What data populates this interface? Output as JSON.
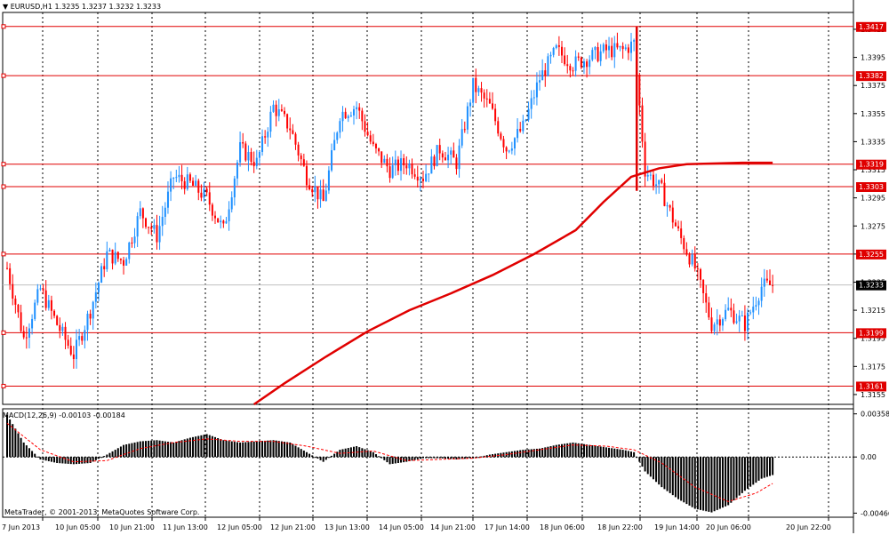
{
  "header": {
    "collapse_arrow": "triangle-down-icon",
    "symbol": "EURUSD,H1",
    "ohlc": "1.3235 1.3237 1.3232 1.3233"
  },
  "macd": {
    "label": "MACD(12,26,9) -0.00103 -0.00184",
    "scale": [
      "0.00358",
      "0.00",
      "-0.00466"
    ]
  },
  "copyright": "MetaTrader, © 2001-2013, MetaQuotes Software Corp.",
  "colors": {
    "grid": "#000000",
    "level_line": "#e00000",
    "ma_line": "#e00000",
    "bull_candle": "#1e90ff",
    "bear_candle": "#ff0000",
    "macd_hist": "#000000",
    "macd_signal": "#ff0000",
    "current_price_line": "#c0c0c0"
  },
  "chart_data": {
    "type": "candlestick",
    "symbol": "EURUSD",
    "timeframe": "H1",
    "price_axis": {
      "ylim": [
        1.3148,
        1.3427
      ],
      "tick_labels": [
        "1.3415",
        "1.3395",
        "1.3375",
        "1.3355",
        "1.3335",
        "1.3315",
        "1.3295",
        "1.3275",
        "1.3255",
        "1.3235",
        "1.3215",
        "1.3195",
        "1.3175",
        "1.3155"
      ]
    },
    "time_axis": {
      "tick_labels": [
        "7 Jun 2013",
        "10 Jun 05:00",
        "10 Jun 21:00",
        "11 Jun 13:00",
        "12 Jun 05:00",
        "12 Jun 21:00",
        "13 Jun 13:00",
        "14 Jun 05:00",
        "14 Jun 21:00",
        "17 Jun 14:00",
        "18 Jun 06:00",
        "18 Jun 22:00",
        "19 Jun 14:00",
        "20 Jun 06:00",
        "20 Jun 22:00"
      ]
    },
    "horizontal_levels": [
      "1.3417",
      "1.3382",
      "1.3319",
      "1.3303",
      "1.3255",
      "1.3199",
      "1.3161"
    ],
    "current_price": "1.3233",
    "price_path": [
      [
        0,
        1.3245
      ],
      [
        6,
        1.3195
      ],
      [
        12,
        1.323
      ],
      [
        18,
        1.3205
      ],
      [
        24,
        1.3183
      ],
      [
        30,
        1.3215
      ],
      [
        36,
        1.3255
      ],
      [
        42,
        1.325
      ],
      [
        48,
        1.3285
      ],
      [
        54,
        1.3268
      ],
      [
        60,
        1.331
      ],
      [
        66,
        1.3305
      ],
      [
        72,
        1.3295
      ],
      [
        78,
        1.3272
      ],
      [
        84,
        1.333
      ],
      [
        90,
        1.332
      ],
      [
        96,
        1.336
      ],
      [
        102,
        1.3345
      ],
      [
        108,
        1.331
      ],
      [
        114,
        1.3292
      ],
      [
        120,
        1.3355
      ],
      [
        126,
        1.336
      ],
      [
        132,
        1.333
      ],
      [
        138,
        1.3315
      ],
      [
        144,
        1.332
      ],
      [
        150,
        1.331
      ],
      [
        156,
        1.333
      ],
      [
        162,
        1.332
      ],
      [
        168,
        1.3375
      ],
      [
        174,
        1.336
      ],
      [
        180,
        1.333
      ],
      [
        186,
        1.3345
      ],
      [
        192,
        1.338
      ],
      [
        198,
        1.34
      ],
      [
        204,
        1.339
      ],
      [
        210,
        1.3395
      ],
      [
        216,
        1.34
      ],
      [
        222,
        1.34
      ],
      [
        226,
        1.3405
      ],
      [
        230,
        1.3315
      ],
      [
        236,
        1.33
      ],
      [
        242,
        1.327
      ],
      [
        248,
        1.3245
      ],
      [
        254,
        1.3205
      ],
      [
        260,
        1.3215
      ],
      [
        266,
        1.3205
      ],
      [
        272,
        1.3232
      ],
      [
        276,
        1.3233
      ]
    ],
    "moving_average": [
      [
        89,
        1.3148
      ],
      [
        100,
        1.3163
      ],
      [
        115,
        1.3182
      ],
      [
        130,
        1.32
      ],
      [
        145,
        1.3215
      ],
      [
        160,
        1.3227
      ],
      [
        175,
        1.324
      ],
      [
        190,
        1.3255
      ],
      [
        205,
        1.3272
      ],
      [
        215,
        1.3292
      ],
      [
        225,
        1.331
      ],
      [
        235,
        1.3316
      ],
      [
        245,
        1.3319
      ],
      [
        265,
        1.332
      ],
      [
        276,
        1.332
      ]
    ],
    "macd_histogram": [
      [
        0,
        0.0035
      ],
      [
        6,
        0.0012
      ],
      [
        12,
        -0.0002
      ],
      [
        18,
        -0.0005
      ],
      [
        24,
        -0.0006
      ],
      [
        30,
        -0.0005
      ],
      [
        36,
        0.0002
      ],
      [
        42,
        0.001
      ],
      [
        48,
        0.0013
      ],
      [
        54,
        0.0014
      ],
      [
        60,
        0.0012
      ],
      [
        66,
        0.0016
      ],
      [
        72,
        0.0019
      ],
      [
        78,
        0.0014
      ],
      [
        84,
        0.0012
      ],
      [
        90,
        0.0013
      ],
      [
        96,
        0.0014
      ],
      [
        102,
        0.0012
      ],
      [
        108,
        0.0004
      ],
      [
        114,
        -0.0004
      ],
      [
        120,
        0.0006
      ],
      [
        126,
        0.0009
      ],
      [
        132,
        0.0004
      ],
      [
        138,
        -0.0006
      ],
      [
        144,
        -0.0004
      ],
      [
        150,
        -0.0001
      ],
      [
        156,
        -0.0001
      ],
      [
        162,
        -0.0002
      ],
      [
        168,
        -0.0001
      ],
      [
        174,
        0.0002
      ],
      [
        180,
        0.0004
      ],
      [
        186,
        0.0006
      ],
      [
        192,
        0.0007
      ],
      [
        198,
        0.001
      ],
      [
        204,
        0.0012
      ],
      [
        210,
        0.001
      ],
      [
        216,
        0.0008
      ],
      [
        222,
        0.0006
      ],
      [
        226,
        0.0004
      ],
      [
        230,
        -0.0012
      ],
      [
        236,
        -0.0025
      ],
      [
        242,
        -0.0035
      ],
      [
        248,
        -0.0043
      ],
      [
        254,
        -0.0046
      ],
      [
        260,
        -0.004
      ],
      [
        266,
        -0.0028
      ],
      [
        272,
        -0.0018
      ],
      [
        276,
        -0.0015
      ]
    ],
    "macd_signal_line": [
      [
        0,
        0.0028
      ],
      [
        12,
        0.0006
      ],
      [
        24,
        -0.0004
      ],
      [
        36,
        -0.0003
      ],
      [
        48,
        0.0007
      ],
      [
        60,
        0.0012
      ],
      [
        72,
        0.0015
      ],
      [
        84,
        0.0013
      ],
      [
        96,
        0.0013
      ],
      [
        108,
        0.0009
      ],
      [
        120,
        0.0003
      ],
      [
        132,
        0.0005
      ],
      [
        144,
        -0.0003
      ],
      [
        156,
        -0.0002
      ],
      [
        168,
        -0.0001
      ],
      [
        180,
        0.0002
      ],
      [
        192,
        0.0006
      ],
      [
        204,
        0.001
      ],
      [
        216,
        0.0009
      ],
      [
        226,
        0.0006
      ],
      [
        236,
        -0.0005
      ],
      [
        248,
        -0.0025
      ],
      [
        260,
        -0.0037
      ],
      [
        270,
        -0.003
      ],
      [
        276,
        -0.0022
      ]
    ],
    "macd_axis": {
      "ylim": [
        -0.005,
        0.004
      ]
    }
  }
}
